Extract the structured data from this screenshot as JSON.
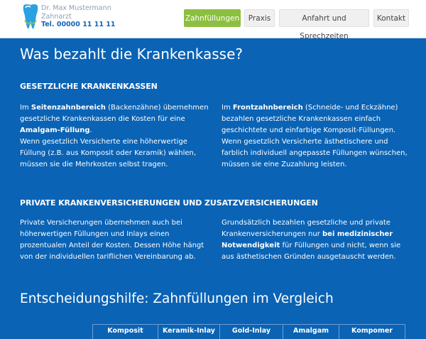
{
  "header": {
    "brand_name": "Dr. Max Mustermann",
    "brand_title": "Zahnarzt",
    "brand_phone": "Tel. 00000 11 11 11",
    "nav": [
      {
        "label": "Zahnfüllungen",
        "active": true
      },
      {
        "label": "Praxis",
        "active": false
      },
      {
        "label": "Anfahrt und Sprechzeiten",
        "active": false
      },
      {
        "label": "Kontakt",
        "active": false
      }
    ]
  },
  "main": {
    "title": "Was bezahlt die Krankenkasse?",
    "section1": {
      "heading": "GESETZLICHE KRANKENKASSEN",
      "left": {
        "p1": "Im",
        "b1": "Seitenzahnbereich",
        "p2": "(Backenzähne) übernehmen gesetzliche Krankenkassen die Kosten für eine",
        "b2": "Amalgam-Füllung",
        "p3": ".",
        "p4": "Wenn gesetzlich Versicherte eine höherwertige Füllung (z.B. aus Komposit oder Keramik) wählen, müssen sie die Mehrkosten selbst tragen."
      },
      "right": {
        "p1": "Im",
        "b1": "Frontzahnbereich",
        "p2": "(Schneide- und Eckzähne) bezahlen gesetzliche Krankenkassen einfach geschichtete und einfarbige Komposit-Füllungen. Wenn gesetzlich Versicherte ästhetischere und farblich individuell angepasste Füllungen wünschen, müssen sie eine Zuzahlung leisten."
      }
    },
    "section2": {
      "heading": "PRIVATE KRANKENVERSICHERUNGEN UND ZUSATZVERSICHERUNGEN",
      "left": {
        "p1": "Private Versicherungen übernehmen auch bei höherwertigen Füllungen und Inlays einen prozentualen Anteil der Kosten. Dessen Höhe hängt von der individuellen tariflichen Vereinbarung ab."
      },
      "right": {
        "p1": "Grundsätzlich bezahlen gesetzliche und private Krankenversicherungen nur",
        "b1": "bei medizinischer Notwendigkeit",
        "p2": "für Füllungen und nicht, wenn sie aus ästhetischen Gründen ausgetauscht werden."
      }
    },
    "comparison_title": "Entscheidungshilfe: Zahnfüllungen im Vergleich",
    "table_headers": [
      "Komposit",
      "Keramik-Inlay",
      "Gold-Inlay",
      "Amalgam",
      "Kompomer"
    ]
  },
  "colors": {
    "background": "#0a63b5",
    "accent": "#8cbf3f",
    "text": "#ffffff"
  }
}
